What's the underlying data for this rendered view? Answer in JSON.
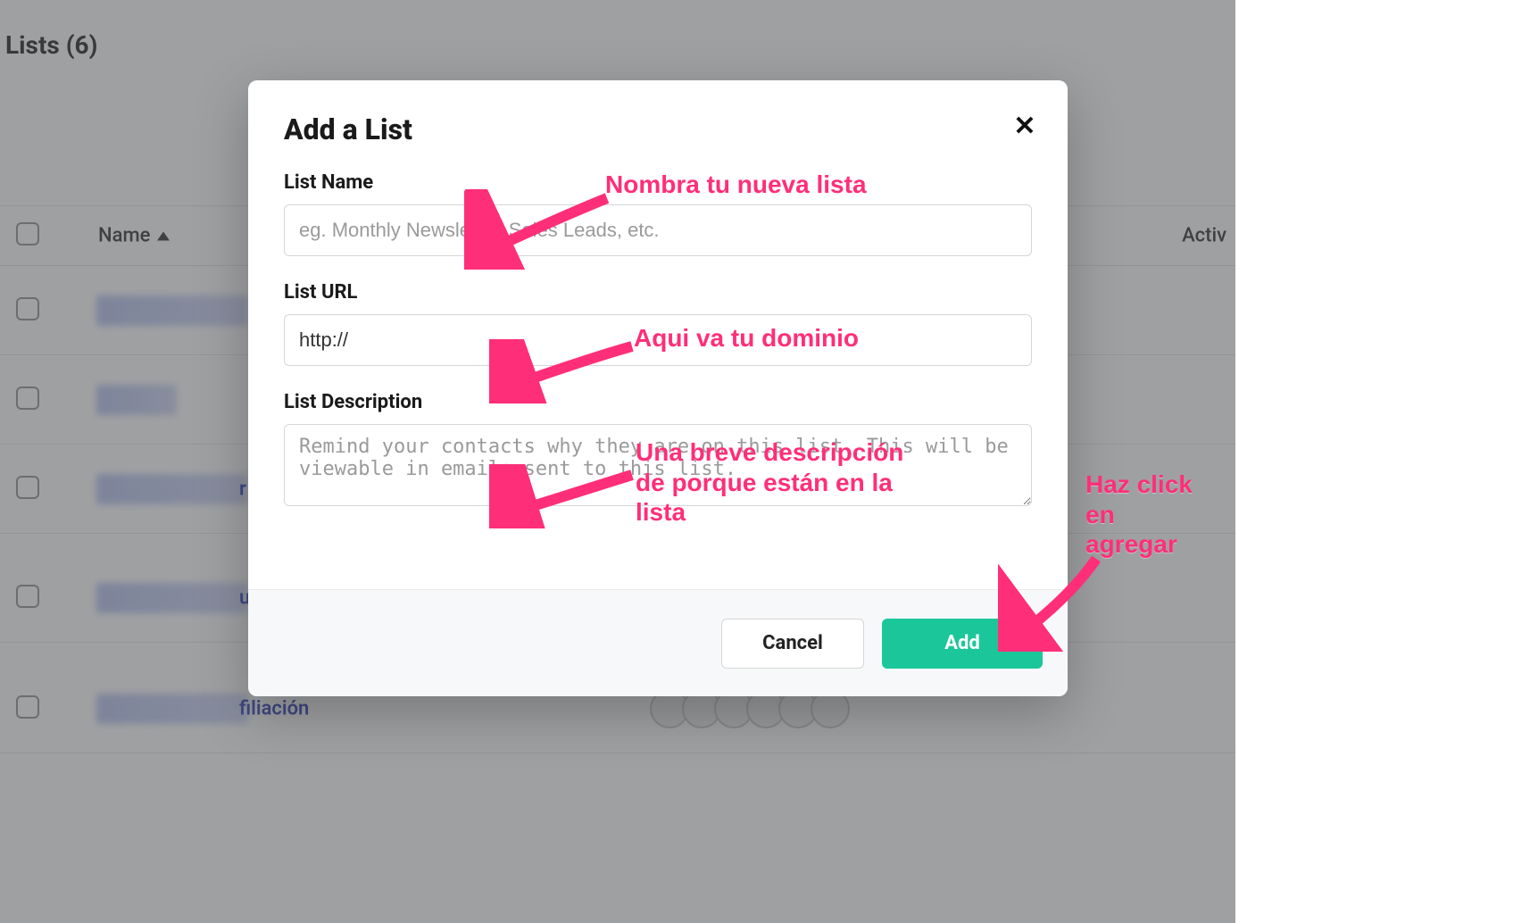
{
  "page": {
    "title": "Lists (6)"
  },
  "table": {
    "header_name": "Name",
    "header_active": "Activ",
    "rows": [
      {
        "letter": ""
      },
      {
        "letter": ""
      },
      {
        "letter": "r"
      },
      {
        "letter": "u"
      },
      {
        "letter": "filiación"
      }
    ]
  },
  "modal": {
    "title": "Add a List",
    "list_name_label": "List Name",
    "list_name_placeholder": "eg. Monthly Newsletter, Sales Leads, etc.",
    "list_url_label": "List URL",
    "list_url_value": "http://",
    "list_desc_label": "List Description",
    "list_desc_placeholder": "Remind your contacts why they are on this list. This will be viewable in emails sent to this list.",
    "cancel": "Cancel",
    "add": "Add"
  },
  "annotations": {
    "a1": "Nombra tu nueva lista",
    "a2": "Aqui va tu dominio",
    "a3": "Una breve descripción\nde porque están en la\nlista",
    "a4": "Haz click\nen\nagregar"
  },
  "colors": {
    "accent": "#ff2e78",
    "primary": "#1bc79a"
  }
}
